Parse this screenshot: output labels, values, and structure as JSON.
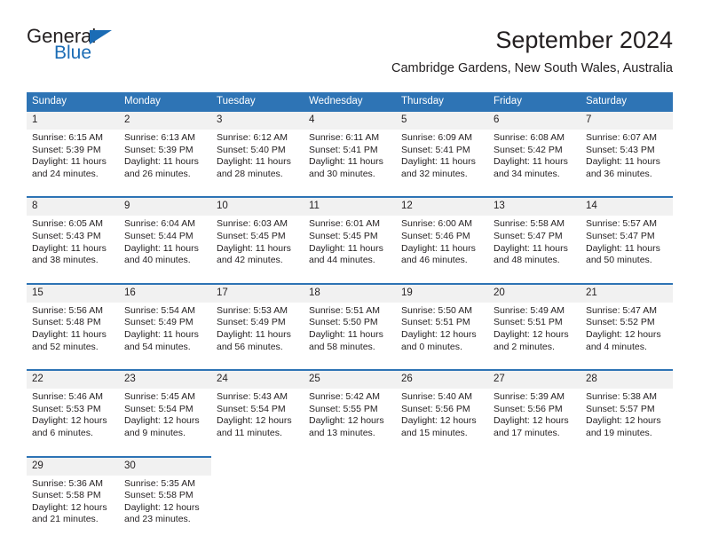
{
  "brand": {
    "name_top": "General",
    "name_bottom": "Blue",
    "accent_color": "#1b6cb5"
  },
  "header": {
    "title": "September 2024",
    "subtitle": "Cambridge Gardens, New South Wales, Australia"
  },
  "theme": {
    "header_blue": "#2e74b5",
    "daynum_background": "#f1f1f1",
    "text_color": "#231f20",
    "page_background": "#ffffff"
  },
  "weekdays": [
    "Sunday",
    "Monday",
    "Tuesday",
    "Wednesday",
    "Thursday",
    "Friday",
    "Saturday"
  ],
  "weeks": [
    [
      {
        "day": "1",
        "sunrise": "Sunrise: 6:15 AM",
        "sunset": "Sunset: 5:39 PM",
        "daylight_1": "Daylight: 11 hours",
        "daylight_2": "and 24 minutes."
      },
      {
        "day": "2",
        "sunrise": "Sunrise: 6:13 AM",
        "sunset": "Sunset: 5:39 PM",
        "daylight_1": "Daylight: 11 hours",
        "daylight_2": "and 26 minutes."
      },
      {
        "day": "3",
        "sunrise": "Sunrise: 6:12 AM",
        "sunset": "Sunset: 5:40 PM",
        "daylight_1": "Daylight: 11 hours",
        "daylight_2": "and 28 minutes."
      },
      {
        "day": "4",
        "sunrise": "Sunrise: 6:11 AM",
        "sunset": "Sunset: 5:41 PM",
        "daylight_1": "Daylight: 11 hours",
        "daylight_2": "and 30 minutes."
      },
      {
        "day": "5",
        "sunrise": "Sunrise: 6:09 AM",
        "sunset": "Sunset: 5:41 PM",
        "daylight_1": "Daylight: 11 hours",
        "daylight_2": "and 32 minutes."
      },
      {
        "day": "6",
        "sunrise": "Sunrise: 6:08 AM",
        "sunset": "Sunset: 5:42 PM",
        "daylight_1": "Daylight: 11 hours",
        "daylight_2": "and 34 minutes."
      },
      {
        "day": "7",
        "sunrise": "Sunrise: 6:07 AM",
        "sunset": "Sunset: 5:43 PM",
        "daylight_1": "Daylight: 11 hours",
        "daylight_2": "and 36 minutes."
      }
    ],
    [
      {
        "day": "8",
        "sunrise": "Sunrise: 6:05 AM",
        "sunset": "Sunset: 5:43 PM",
        "daylight_1": "Daylight: 11 hours",
        "daylight_2": "and 38 minutes."
      },
      {
        "day": "9",
        "sunrise": "Sunrise: 6:04 AM",
        "sunset": "Sunset: 5:44 PM",
        "daylight_1": "Daylight: 11 hours",
        "daylight_2": "and 40 minutes."
      },
      {
        "day": "10",
        "sunrise": "Sunrise: 6:03 AM",
        "sunset": "Sunset: 5:45 PM",
        "daylight_1": "Daylight: 11 hours",
        "daylight_2": "and 42 minutes."
      },
      {
        "day": "11",
        "sunrise": "Sunrise: 6:01 AM",
        "sunset": "Sunset: 5:45 PM",
        "daylight_1": "Daylight: 11 hours",
        "daylight_2": "and 44 minutes."
      },
      {
        "day": "12",
        "sunrise": "Sunrise: 6:00 AM",
        "sunset": "Sunset: 5:46 PM",
        "daylight_1": "Daylight: 11 hours",
        "daylight_2": "and 46 minutes."
      },
      {
        "day": "13",
        "sunrise": "Sunrise: 5:58 AM",
        "sunset": "Sunset: 5:47 PM",
        "daylight_1": "Daylight: 11 hours",
        "daylight_2": "and 48 minutes."
      },
      {
        "day": "14",
        "sunrise": "Sunrise: 5:57 AM",
        "sunset": "Sunset: 5:47 PM",
        "daylight_1": "Daylight: 11 hours",
        "daylight_2": "and 50 minutes."
      }
    ],
    [
      {
        "day": "15",
        "sunrise": "Sunrise: 5:56 AM",
        "sunset": "Sunset: 5:48 PM",
        "daylight_1": "Daylight: 11 hours",
        "daylight_2": "and 52 minutes."
      },
      {
        "day": "16",
        "sunrise": "Sunrise: 5:54 AM",
        "sunset": "Sunset: 5:49 PM",
        "daylight_1": "Daylight: 11 hours",
        "daylight_2": "and 54 minutes."
      },
      {
        "day": "17",
        "sunrise": "Sunrise: 5:53 AM",
        "sunset": "Sunset: 5:49 PM",
        "daylight_1": "Daylight: 11 hours",
        "daylight_2": "and 56 minutes."
      },
      {
        "day": "18",
        "sunrise": "Sunrise: 5:51 AM",
        "sunset": "Sunset: 5:50 PM",
        "daylight_1": "Daylight: 11 hours",
        "daylight_2": "and 58 minutes."
      },
      {
        "day": "19",
        "sunrise": "Sunrise: 5:50 AM",
        "sunset": "Sunset: 5:51 PM",
        "daylight_1": "Daylight: 12 hours",
        "daylight_2": "and 0 minutes."
      },
      {
        "day": "20",
        "sunrise": "Sunrise: 5:49 AM",
        "sunset": "Sunset: 5:51 PM",
        "daylight_1": "Daylight: 12 hours",
        "daylight_2": "and 2 minutes."
      },
      {
        "day": "21",
        "sunrise": "Sunrise: 5:47 AM",
        "sunset": "Sunset: 5:52 PM",
        "daylight_1": "Daylight: 12 hours",
        "daylight_2": "and 4 minutes."
      }
    ],
    [
      {
        "day": "22",
        "sunrise": "Sunrise: 5:46 AM",
        "sunset": "Sunset: 5:53 PM",
        "daylight_1": "Daylight: 12 hours",
        "daylight_2": "and 6 minutes."
      },
      {
        "day": "23",
        "sunrise": "Sunrise: 5:45 AM",
        "sunset": "Sunset: 5:54 PM",
        "daylight_1": "Daylight: 12 hours",
        "daylight_2": "and 9 minutes."
      },
      {
        "day": "24",
        "sunrise": "Sunrise: 5:43 AM",
        "sunset": "Sunset: 5:54 PM",
        "daylight_1": "Daylight: 12 hours",
        "daylight_2": "and 11 minutes."
      },
      {
        "day": "25",
        "sunrise": "Sunrise: 5:42 AM",
        "sunset": "Sunset: 5:55 PM",
        "daylight_1": "Daylight: 12 hours",
        "daylight_2": "and 13 minutes."
      },
      {
        "day": "26",
        "sunrise": "Sunrise: 5:40 AM",
        "sunset": "Sunset: 5:56 PM",
        "daylight_1": "Daylight: 12 hours",
        "daylight_2": "and 15 minutes."
      },
      {
        "day": "27",
        "sunrise": "Sunrise: 5:39 AM",
        "sunset": "Sunset: 5:56 PM",
        "daylight_1": "Daylight: 12 hours",
        "daylight_2": "and 17 minutes."
      },
      {
        "day": "28",
        "sunrise": "Sunrise: 5:38 AM",
        "sunset": "Sunset: 5:57 PM",
        "daylight_1": "Daylight: 12 hours",
        "daylight_2": "and 19 minutes."
      }
    ],
    [
      {
        "day": "29",
        "sunrise": "Sunrise: 5:36 AM",
        "sunset": "Sunset: 5:58 PM",
        "daylight_1": "Daylight: 12 hours",
        "daylight_2": "and 21 minutes."
      },
      {
        "day": "30",
        "sunrise": "Sunrise: 5:35 AM",
        "sunset": "Sunset: 5:58 PM",
        "daylight_1": "Daylight: 12 hours",
        "daylight_2": "and 23 minutes."
      },
      {
        "day": "",
        "sunrise": "",
        "sunset": "",
        "daylight_1": "",
        "daylight_2": ""
      },
      {
        "day": "",
        "sunrise": "",
        "sunset": "",
        "daylight_1": "",
        "daylight_2": ""
      },
      {
        "day": "",
        "sunrise": "",
        "sunset": "",
        "daylight_1": "",
        "daylight_2": ""
      },
      {
        "day": "",
        "sunrise": "",
        "sunset": "",
        "daylight_1": "",
        "daylight_2": ""
      },
      {
        "day": "",
        "sunrise": "",
        "sunset": "",
        "daylight_1": "",
        "daylight_2": ""
      }
    ]
  ]
}
